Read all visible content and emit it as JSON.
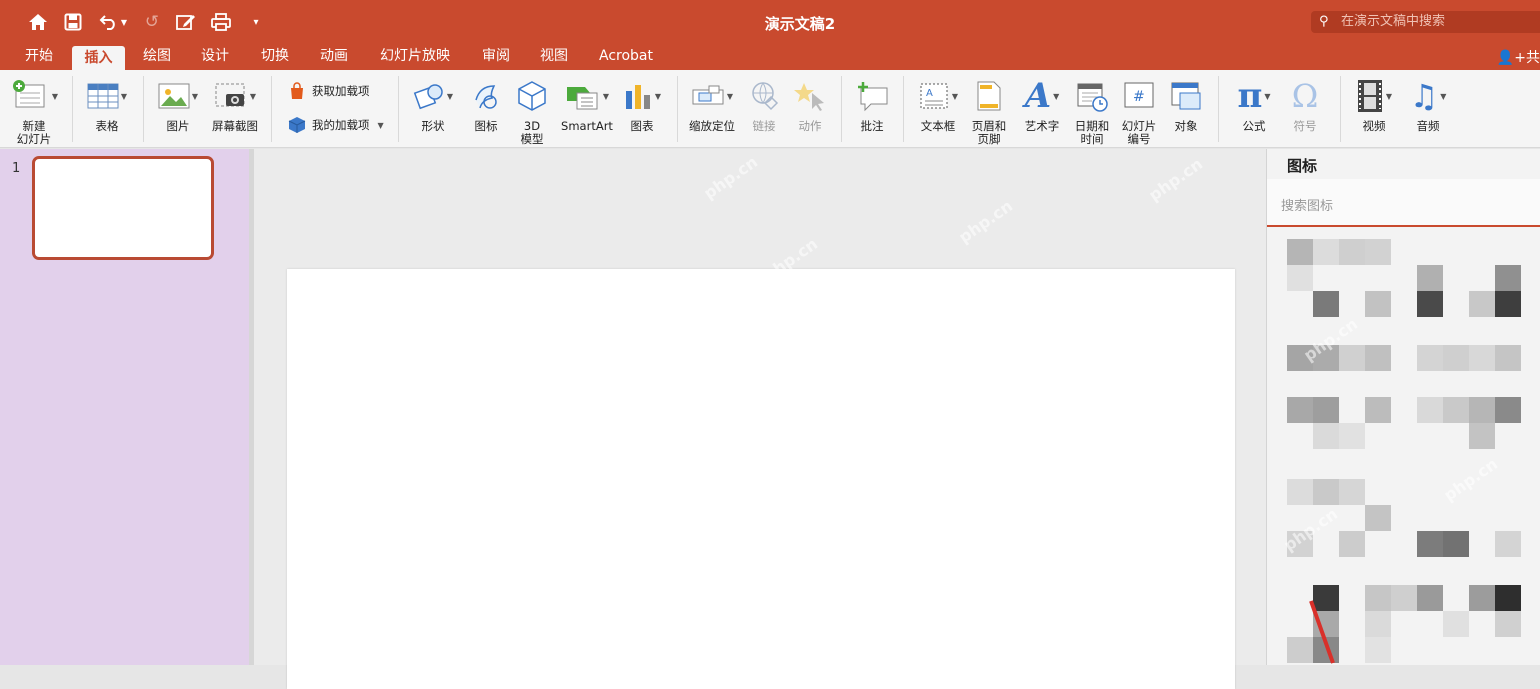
{
  "titlebar": {
    "title": "演示文稿2",
    "search_placeholder": "在演示文稿中搜索",
    "quick_access": [
      "home-icon",
      "save-icon",
      "undo-icon",
      "redo-icon",
      "edit-icon",
      "print-icon",
      "customize-icon"
    ]
  },
  "tabs": [
    {
      "label": "开始"
    },
    {
      "label": "插入",
      "active": true
    },
    {
      "label": "绘图"
    },
    {
      "label": "设计"
    },
    {
      "label": "切换"
    },
    {
      "label": "动画"
    },
    {
      "label": "幻灯片放映"
    },
    {
      "label": "审阅"
    },
    {
      "label": "视图"
    },
    {
      "label": "Acrobat"
    }
  ],
  "share_label": "共",
  "ribbon": {
    "new_slide": "新建\n幻灯片",
    "table": "表格",
    "pictures": "图片",
    "screenshot": "屏幕截图",
    "get_addins": "获取加载项",
    "my_addins": "我的加载项",
    "shapes": "形状",
    "icons": "图标",
    "models_3d": "3D\n模型",
    "smartart": "SmartArt",
    "chart": "图表",
    "zoom": "缩放定位",
    "link": "链接",
    "action": "动作",
    "comment": "批注",
    "textbox": "文本框",
    "header_footer": "页眉和\n页脚",
    "wordart": "艺术字",
    "datetime": "日期和\n时间",
    "slide_number": "幻灯片\n编号",
    "object": "对象",
    "equation": "公式",
    "symbol": "符号",
    "video": "视频",
    "audio": "音频"
  },
  "slides_pane": {
    "slide_number": "1"
  },
  "icons_pane": {
    "title": "图标",
    "search_placeholder": "搜索图标"
  },
  "watermark": "php.cn",
  "colors": {
    "accent": "#c94a2e",
    "slides_pane_bg": "#e2d0eb",
    "selected_border": "#b94a33"
  }
}
